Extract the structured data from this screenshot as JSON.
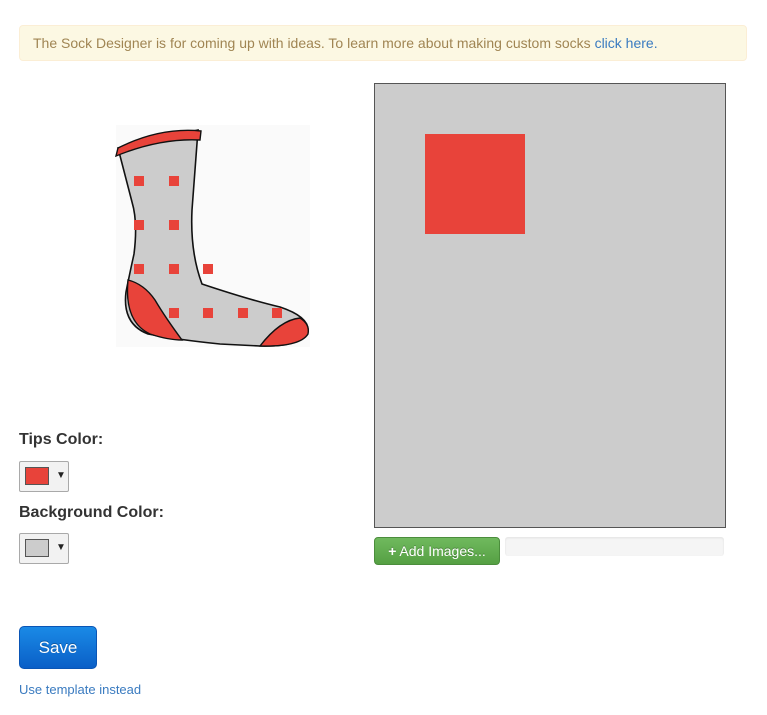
{
  "notice": {
    "text": "The Sock Designer is for coming up with ideas. To learn more about making custom socks ",
    "link_text": "click here."
  },
  "tips": {
    "label": "Tips Color:",
    "color": "#e8433a"
  },
  "background": {
    "label": "Background Color:",
    "color": "#cccccc"
  },
  "sock": {
    "body_color": "#cccccc",
    "tips_color": "#e8433a",
    "pattern_color": "#e8433a"
  },
  "canvas": {
    "background": "#cccccc",
    "element_color": "#e8433a"
  },
  "upload": {
    "button_label": "Add Images...",
    "icon": "plus-icon"
  },
  "actions": {
    "save_label": "Save",
    "template_link": "Use template instead"
  }
}
